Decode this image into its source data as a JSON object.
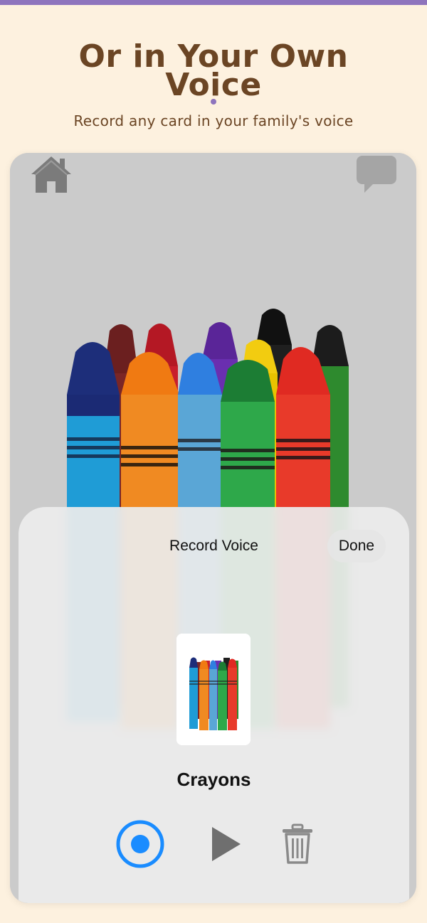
{
  "promo": {
    "title_line1": "Or in Your Own",
    "title_line2": "Voice",
    "subtitle": "Record any card in your family's voice"
  },
  "colors": {
    "accent_purple": "#8e74bd",
    "heading_brown": "#6b4524",
    "page_background": "#fdf1df",
    "record_blue": "#1a8cff",
    "icon_gray": "#7b7b7b"
  },
  "app": {
    "home_icon": "home-icon",
    "chat_icon": "speech-bubble-icon"
  },
  "record_sheet": {
    "title": "Record Voice",
    "done_label": "Done",
    "card_name": "Crayons",
    "controls": {
      "record_icon": "record-icon",
      "play_icon": "play-icon",
      "delete_icon": "trash-icon"
    }
  }
}
